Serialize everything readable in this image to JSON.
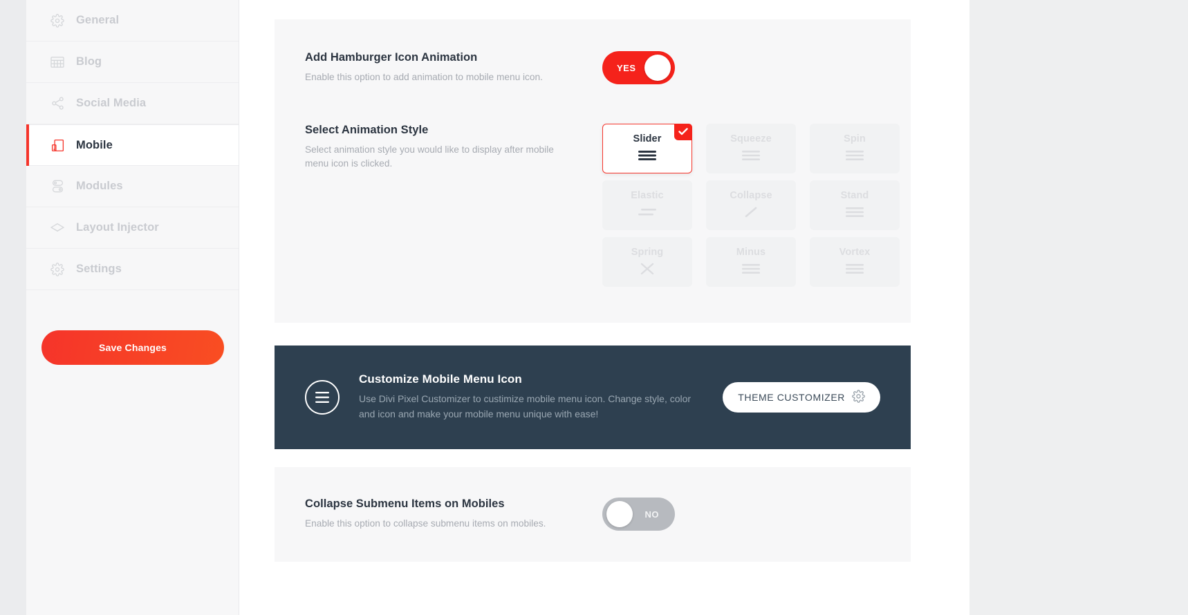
{
  "sidebar": {
    "items": [
      {
        "label": "General",
        "icon": "gear-icon",
        "active": false
      },
      {
        "label": "Blog",
        "icon": "grid-icon",
        "active": false
      },
      {
        "label": "Social Media",
        "icon": "share-icon",
        "active": false
      },
      {
        "label": "Mobile",
        "icon": "mobile-icon",
        "active": true
      },
      {
        "label": "Modules",
        "icon": "modules-icon",
        "active": false
      },
      {
        "label": "Layout Injector",
        "icon": "layout-icon",
        "active": false
      },
      {
        "label": "Settings",
        "icon": "gear-icon",
        "active": false
      }
    ],
    "save_label": "Save Changes"
  },
  "options": {
    "hamburger": {
      "title": "Add Hamburger Icon Animation",
      "description": "Enable this option to add animation to mobile menu icon.",
      "toggle_value": "YES",
      "toggle_state": "on"
    },
    "animation_style": {
      "title": "Select Animation Style",
      "description": "Select animation style you would like to display after mobile menu icon is clicked.",
      "selected": "Slider",
      "styles": [
        {
          "label": "Slider",
          "icon": "three-bars-icon",
          "selected": true
        },
        {
          "label": "Squeeze",
          "icon": "three-bars-icon",
          "selected": false
        },
        {
          "label": "Spin",
          "icon": "three-bars-icon",
          "selected": false
        },
        {
          "label": "Elastic",
          "icon": "two-bars-offset-icon",
          "selected": false
        },
        {
          "label": "Collapse",
          "icon": "diagonal-line-icon",
          "selected": false
        },
        {
          "label": "Stand",
          "icon": "three-bars-icon",
          "selected": false
        },
        {
          "label": "Spring",
          "icon": "cross-icon",
          "selected": false
        },
        {
          "label": "Minus",
          "icon": "three-bars-icon",
          "selected": false
        },
        {
          "label": "Vortex",
          "icon": "three-bars-icon",
          "selected": false
        }
      ]
    },
    "collapse_submenu": {
      "title": "Collapse Submenu Items on Mobiles",
      "description": "Enable this option to collapse submenu items on mobiles.",
      "toggle_value": "NO",
      "toggle_state": "off"
    }
  },
  "promo": {
    "icon": "hamburger-circle-icon",
    "title": "Customize Mobile Menu Icon",
    "description": "Use Divi Pixel Customizer to custimize mobile menu icon. Change style, color and icon and make your mobile menu unique with ease!",
    "button_label": "THEME CUSTOMIZER",
    "button_icon": "gear-icon"
  },
  "colors": {
    "accent_red": "#f5342a",
    "toggle_on": "#f5221b",
    "toggle_off": "#b7babf",
    "promo_bg": "#2e4050",
    "text_dark": "#2b3440",
    "text_muted": "#a7abb2"
  }
}
